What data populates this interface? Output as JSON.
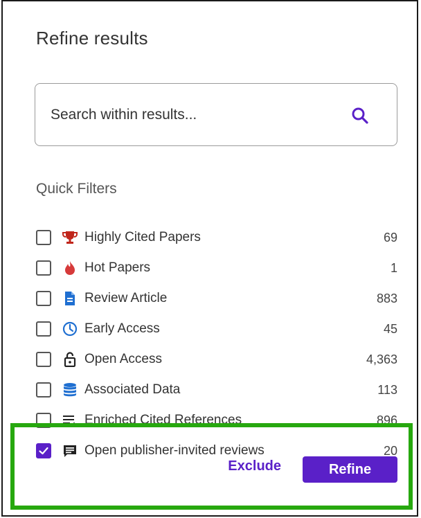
{
  "panel": {
    "title": "Refine results",
    "search": {
      "placeholder": "Search within results..."
    },
    "quick_filters_label": "Quick Filters",
    "filters": [
      {
        "label": "Highly Cited Papers",
        "count": "69",
        "icon": "trophy-icon",
        "checked": false
      },
      {
        "label": "Hot Papers",
        "count": "1",
        "icon": "flame-icon",
        "checked": false
      },
      {
        "label": "Review Article",
        "count": "883",
        "icon": "document-icon",
        "checked": false
      },
      {
        "label": "Early Access",
        "count": "45",
        "icon": "clock-icon",
        "checked": false
      },
      {
        "label": "Open Access",
        "count": "4,363",
        "icon": "unlock-icon",
        "checked": false
      },
      {
        "label": "Associated Data",
        "count": "113",
        "icon": "database-icon",
        "checked": false
      },
      {
        "label": "Enriched Cited References",
        "count": "896",
        "icon": "enriched-list-icon",
        "checked": false
      },
      {
        "label": "Open publisher-invited reviews",
        "count": "20",
        "icon": "comment-icon",
        "checked": true
      }
    ],
    "exclude_label": "Exclude",
    "refine_label": "Refine"
  },
  "colors": {
    "accent": "#5a20c8",
    "highlight_border": "#27a80f",
    "trophy": "#c0261b",
    "flame": "#d63a3a",
    "document": "#1f6fd1",
    "clock": "#1f6fd1",
    "database": "#1f6fd1"
  }
}
